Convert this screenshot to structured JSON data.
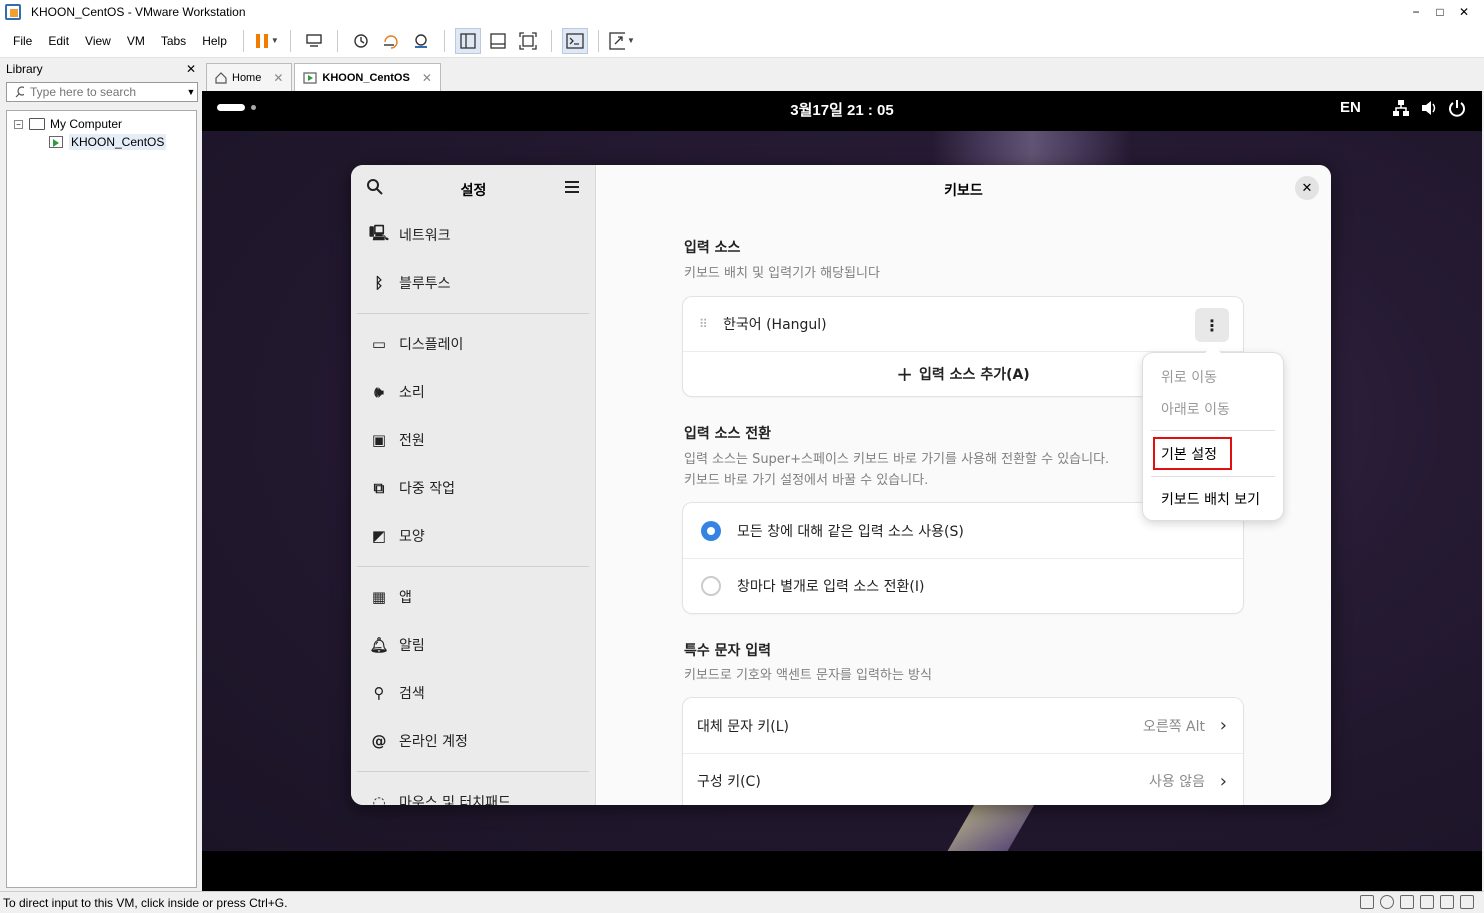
{
  "window": {
    "title": "KHOON_CentOS - VMware Workstation",
    "min": "−",
    "max": "□",
    "close": "✕"
  },
  "menubar": [
    "File",
    "Edit",
    "View",
    "VM",
    "Tabs",
    "Help"
  ],
  "library": {
    "title": "Library",
    "close": "✕",
    "search_placeholder": "Type here to search",
    "tree": {
      "root": "My Computer",
      "vm": "KHOON_CentOS",
      "expander": "−"
    }
  },
  "tabs": [
    {
      "label": "Home",
      "close": "✕"
    },
    {
      "label": "KHOON_CentOS",
      "close": "✕"
    }
  ],
  "statusbar": {
    "message": "To direct input to this VM, click inside or press Ctrl+G."
  },
  "guest": {
    "clock": "3월17일  21 : 05",
    "lang": "EN"
  },
  "settings": {
    "sidebar_title": "설정",
    "sidebar_groups": [
      [
        "네트워크",
        "블루투스"
      ],
      [
        "디스플레이",
        "소리",
        "전원",
        "다중 작업",
        "모양"
      ],
      [
        "앱",
        "알림",
        "검색",
        "온라인 계정"
      ],
      [
        "마우스 및 터치패드"
      ]
    ],
    "page_title": "키보드",
    "close": "✕",
    "input_sources": {
      "title": "입력 소스",
      "desc": "키보드 배치 및 입력기가 해당됩니다",
      "source": "한국어 (Hangul)",
      "add": "입력 소스 추가(A)"
    },
    "switching": {
      "title": "입력 소스 전환",
      "desc_line1": "입력 소스는 Super+스페이스 키보드 바로 가기를 사용해 전환할 수 있습니다.",
      "desc_line2": "키보드 바로 가기 설정에서 바꿀 수 있습니다.",
      "option_same": "모든 창에 대해 같은 입력 소스 사용(S)",
      "option_each": "창마다 별개로 입력 소스 전환(I)"
    },
    "special": {
      "title": "특수 문자 입력",
      "desc": "키보드로 기호와 액센트 문자를 입력하는 방식",
      "alt_label": "대체 문자 키(L)",
      "alt_value": "오른쪽 Alt",
      "compose_label": "구성 키(C)",
      "compose_value": "사용 않음"
    },
    "popover": {
      "move_up": "위로 이동",
      "move_down": "아래로 이동",
      "preferences": "기본 설정",
      "view_layout": "키보드 배치 보기"
    }
  },
  "colors": {
    "accent": "#3584e4",
    "highlight_box": "#e01010",
    "pause": "#f07d00"
  }
}
